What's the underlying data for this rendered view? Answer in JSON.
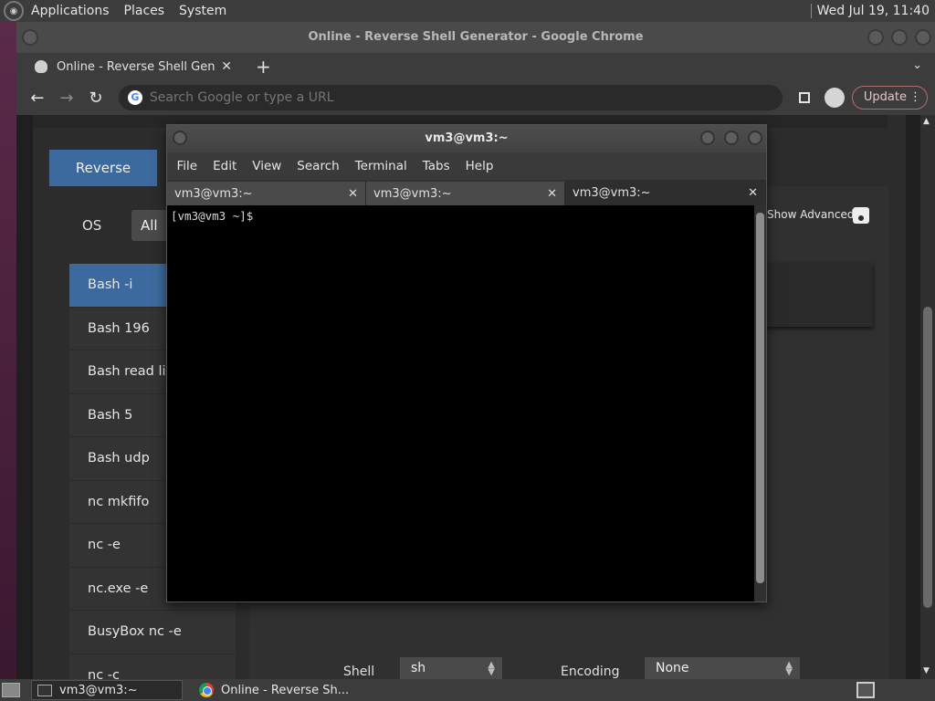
{
  "top_panel": {
    "menus": [
      "Applications",
      "Places",
      "System"
    ],
    "clock": "Wed Jul 19, 11:40"
  },
  "chrome": {
    "window_title": "Online - Reverse Shell Generator - Google Chrome",
    "tab_title": "Online - Reverse Shell Genera",
    "new_tab": "+",
    "omnibox_placeholder": "Search Google or type a URL",
    "update_label": "Update"
  },
  "page": {
    "reverse_tab": "Reverse",
    "os_label": "OS",
    "os_all": "All",
    "shells": [
      "Bash -i",
      "Bash 196",
      "Bash read line",
      "Bash 5",
      "Bash udp",
      "nc mkfifo",
      "nc -e",
      "nc.exe -e",
      "BusyBox nc -e",
      "nc -c"
    ],
    "show_advanced": "Show Advanced",
    "shell_label": "Shell",
    "shell_value": "sh",
    "encoding_label": "Encoding",
    "encoding_value": "None"
  },
  "terminal": {
    "title": "vm3@vm3:~",
    "menu": [
      "File",
      "Edit",
      "View",
      "Search",
      "Terminal",
      "Tabs",
      "Help"
    ],
    "tabs": [
      "vm3@vm3:~",
      "vm3@vm3:~",
      "vm3@vm3:~"
    ],
    "prompt": "[vm3@vm3 ~]$"
  },
  "taskbar": {
    "terminal_task": "vm3@vm3:~",
    "chrome_task": "Online - Reverse Sh..."
  },
  "colors": {
    "accent_blue": "#3d6a9e",
    "update_border": "#b56a6a"
  }
}
